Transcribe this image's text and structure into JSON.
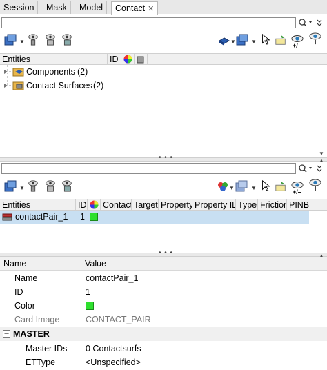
{
  "tabs": [
    {
      "label": "Session"
    },
    {
      "label": "Mask"
    },
    {
      "label": "Model"
    },
    {
      "label": "Contact",
      "close": "✕"
    }
  ],
  "search": {
    "value": "",
    "icons": "⚲ ▾ ⌄"
  },
  "top_panel": {
    "headers": {
      "entities": "Entities",
      "id": "ID"
    },
    "rows": [
      {
        "label": "Components",
        "count": "(2)"
      },
      {
        "label": "Contact Surfaces",
        "count": "(2)"
      }
    ],
    "plus_minus": "+/–"
  },
  "bottom_panel": {
    "headers": [
      "Entities",
      "ID",
      "",
      "Contact",
      "Target",
      "Property",
      "Property ID",
      "Type",
      "Friction",
      "PINB"
    ],
    "rows": [
      {
        "name": "contactPair_1",
        "id": "1"
      }
    ]
  },
  "properties": {
    "header_name": "Name",
    "header_value": "Value",
    "rows": [
      {
        "name": "Name",
        "value": "contactPair_1"
      },
      {
        "name": "ID",
        "value": "1"
      },
      {
        "name": "Color",
        "value": ""
      },
      {
        "name": "Card Image",
        "value": "CONTACT_PAIR"
      }
    ],
    "section": {
      "toggle": "–",
      "label": "MASTER"
    },
    "sub_rows": [
      {
        "name": "Master IDs",
        "value": "0 Contactsurfs"
      },
      {
        "name": "ETType",
        "value": "<Unspecified>"
      }
    ]
  },
  "colors": {
    "selected_row": "#c8dff2",
    "swatch": "#2ee02e",
    "folder": "#e9b64a",
    "component": "#2a5db0"
  }
}
